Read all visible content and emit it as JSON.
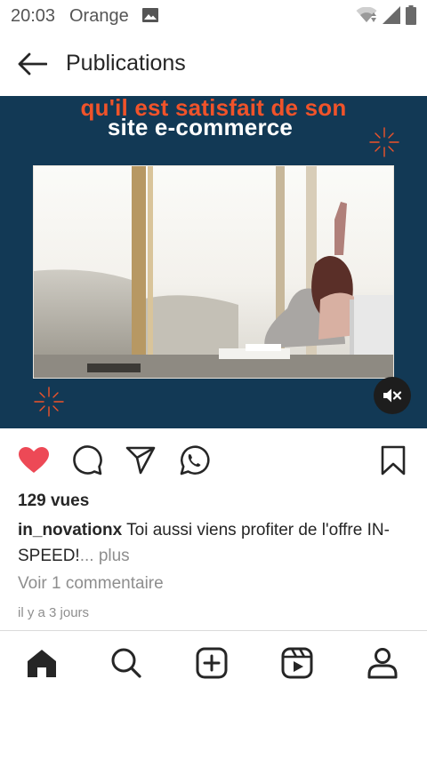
{
  "status_bar": {
    "time": "20:03",
    "carrier": "Orange",
    "icons": [
      "gallery-icon",
      "wifi-icon",
      "cell-signal-icon",
      "battery-icon"
    ]
  },
  "header": {
    "title": "Publications",
    "back_icon": "arrow-left-icon"
  },
  "post": {
    "media": {
      "overlay_line1": "qu'il est satisfait de son",
      "overlay_line2": "site e-commerce",
      "background_color": "#123955",
      "accent_color": "#f0532a",
      "sound": "muted"
    },
    "actions": {
      "liked": true,
      "like_color": "#ed4956",
      "icons": [
        "heart-icon",
        "comment-icon",
        "share-icon",
        "whatsapp-icon",
        "bookmark-icon"
      ]
    },
    "views": "129 vues",
    "caption": {
      "username": "in_novationx",
      "text": " Toi aussi viens profiter de l'offre IN-SPEED!",
      "more": "... plus"
    },
    "comments_link": "Voir 1 commentaire",
    "timestamp": "il y a 3 jours"
  },
  "bottom_nav": {
    "items": [
      "home-icon",
      "search-icon",
      "create-icon",
      "reels-icon",
      "profile-icon"
    ],
    "active": "home-icon"
  }
}
